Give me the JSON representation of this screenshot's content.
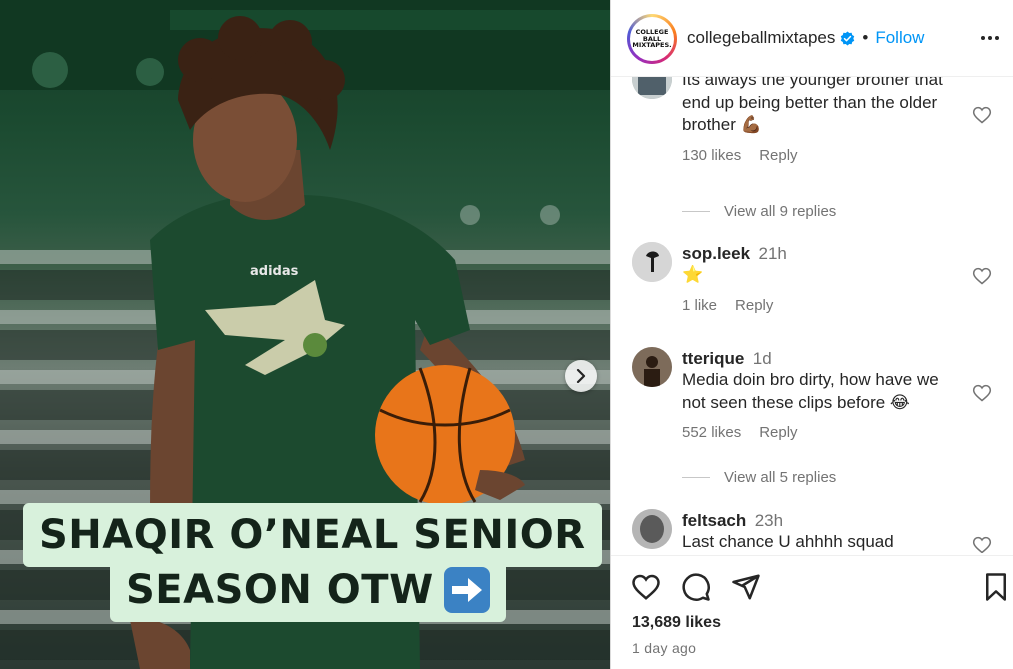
{
  "header": {
    "username": "collegeballmixtapes",
    "separator": "•",
    "follow_label": "Follow",
    "avatar_text": [
      "COLLEGE",
      "BALL",
      "MIXTAPES."
    ]
  },
  "post_image": {
    "caption_line1": "SHAQIR O’NEAL SENIOR",
    "caption_line2": "SEASON OTW",
    "caption_emoji": "right-arrow-emoji",
    "next_arrow_icon": "chevron-right-icon",
    "colors": {
      "caption_bg": "#d8f1dc",
      "caption_text": "#14241a",
      "jersey": "#1c4a2f",
      "ball": "#e8751a"
    }
  },
  "comments": [
    {
      "username": "",
      "text": "Its always the younger brother that end up being better than the older brother 💪🏾",
      "likes": "130 likes",
      "reply_label": "Reply",
      "view_replies": "View all 9 replies"
    },
    {
      "username": "sop.leek",
      "time": "21h",
      "text": "⭐",
      "likes": "1 like",
      "reply_label": "Reply"
    },
    {
      "username": "tterique",
      "time": "1d",
      "text": "Media doin bro dirty, how have we not seen these clips before 😂",
      "likes": "552 likes",
      "reply_label": "Reply",
      "view_replies": "View all 5 replies"
    },
    {
      "username": "feltsach",
      "time": "23h",
      "text": "Last chance U ahhhh squad"
    }
  ],
  "actions": {
    "like_icon": "heart-icon",
    "comment_icon": "comment-icon",
    "share_icon": "send-icon",
    "save_icon": "bookmark-icon"
  },
  "footer": {
    "likes": "13,689 likes",
    "date": "1 day ago"
  },
  "colors": {
    "link_blue": "#0095f6",
    "muted_text": "#737373",
    "primary_text": "#262626"
  }
}
